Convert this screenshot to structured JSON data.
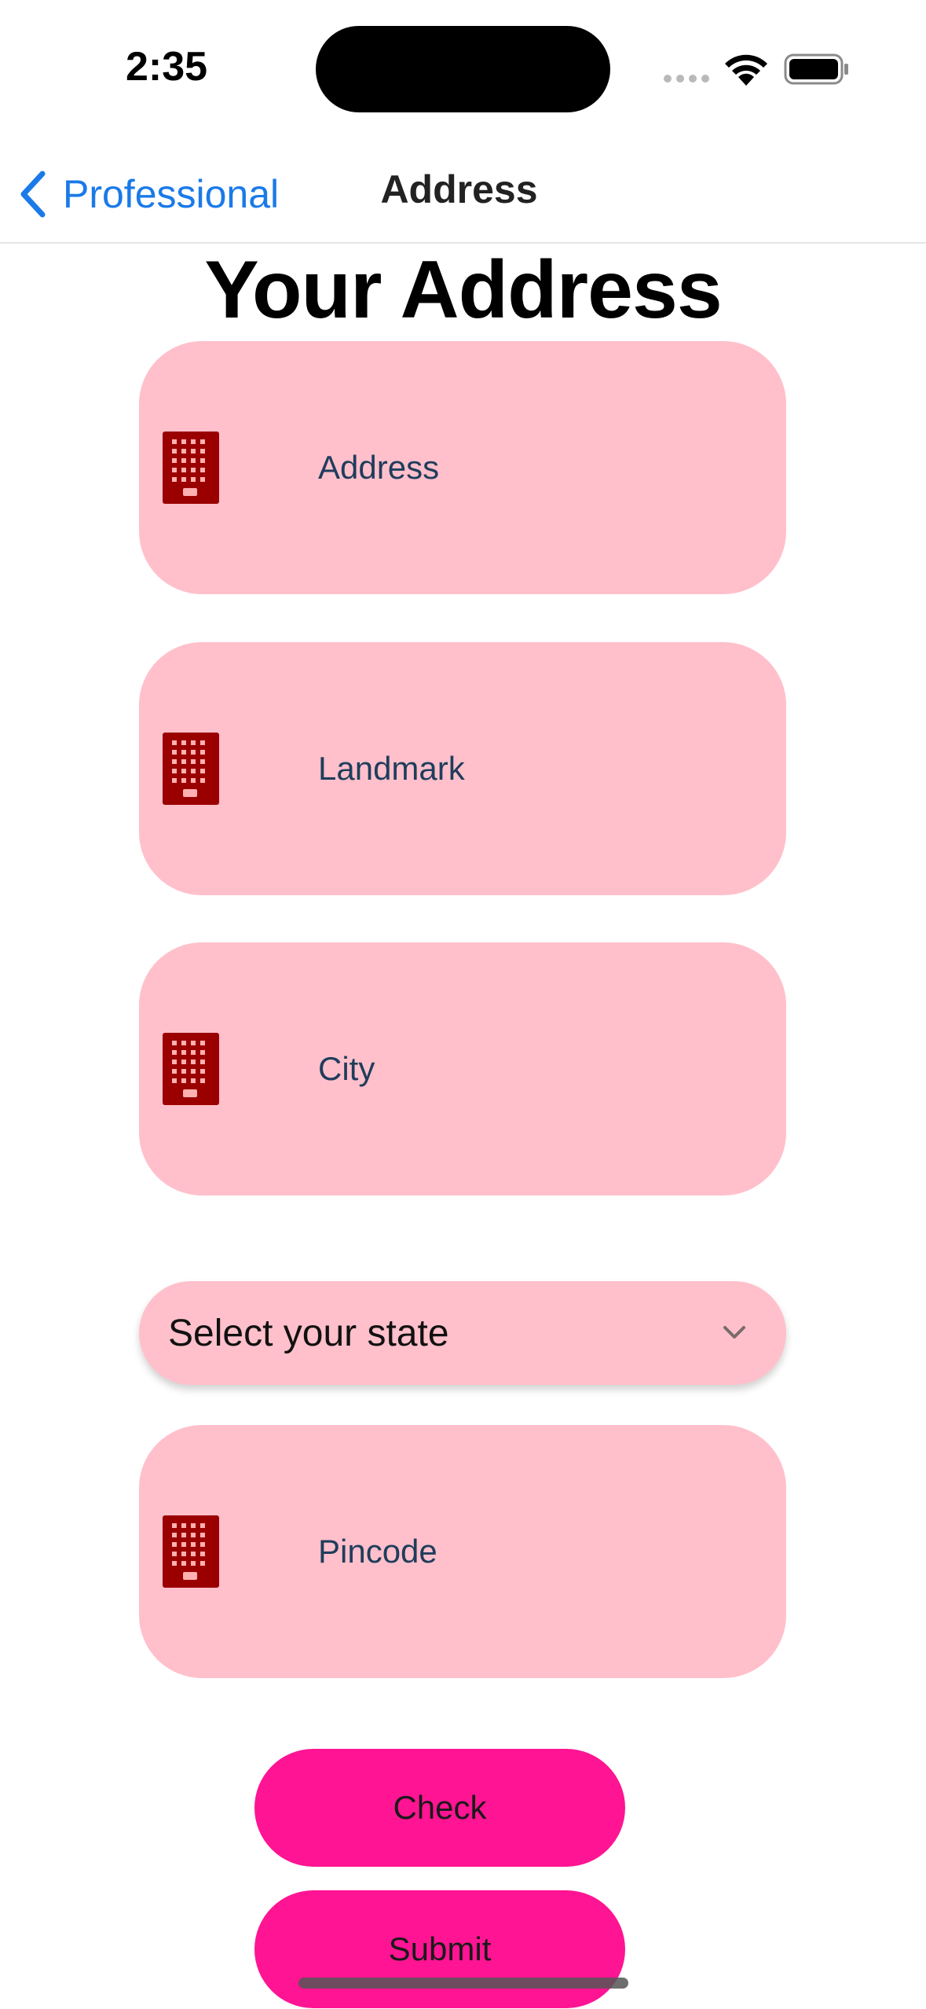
{
  "status_bar": {
    "time": "2:35"
  },
  "nav": {
    "back_label": "Professional",
    "title": "Address"
  },
  "page": {
    "heading": "Your Address"
  },
  "fields": [
    {
      "label": "Address",
      "icon": "building-icon"
    },
    {
      "label": "Landmark",
      "icon": "building-icon"
    },
    {
      "label": "City",
      "icon": "building-icon"
    },
    {
      "label": "Pincode",
      "icon": "building-icon"
    }
  ],
  "state_select": {
    "selected": "Select your state",
    "icon": "chevron-down-icon"
  },
  "buttons": {
    "check": "Check",
    "submit": "Submit"
  },
  "colors": {
    "field_bg": "#ffc0cb",
    "button_bg": "#ff1493",
    "icon_color": "#9b0000",
    "link_blue": "#1a7ae8"
  }
}
